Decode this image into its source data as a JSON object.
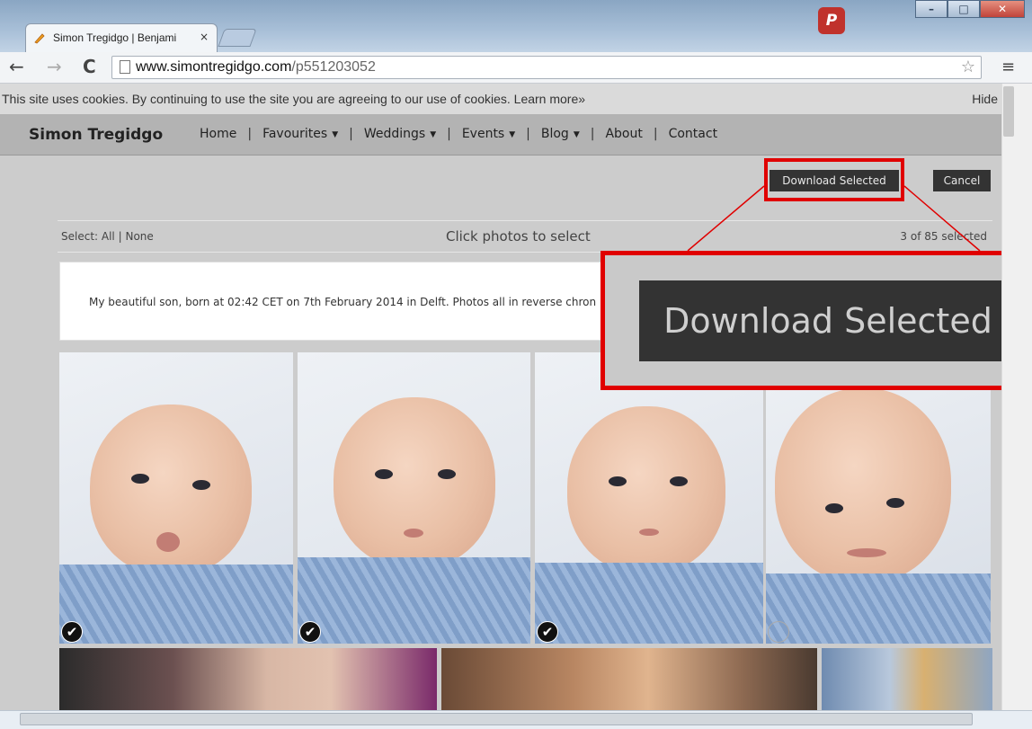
{
  "browser": {
    "tab_title": "Simon Tregidgo | Benjami",
    "tab_close": "×",
    "url_host": "www.simontregidgo.com",
    "url_path": "/p551203052",
    "ext_badge": "P"
  },
  "cookie_bar": {
    "text": "This site uses cookies. By continuing to use the site you are agreeing to our use of cookies.",
    "link": "Learn more»",
    "hide": "Hide"
  },
  "site": {
    "brand": "Simon Tregidgo",
    "nav": [
      "Home",
      "Favourites",
      "Weddings",
      "Events",
      "Blog",
      "About",
      "Contact"
    ],
    "separator": "|"
  },
  "actions": {
    "download": "Download Selected",
    "cancel": "Cancel"
  },
  "selection": {
    "select_label": "Select:",
    "all": "All",
    "sep": "|",
    "none": "None",
    "instruction": "Click photos to select",
    "count": "3 of 85 selected"
  },
  "gallery": {
    "description": "My beautiful son, born at 02:42 CET on 7th February 2014 in Delft. Photos all in reverse chron",
    "photos_selected": [
      true,
      true,
      true,
      false
    ]
  },
  "callout": {
    "label": "Download Selected"
  }
}
